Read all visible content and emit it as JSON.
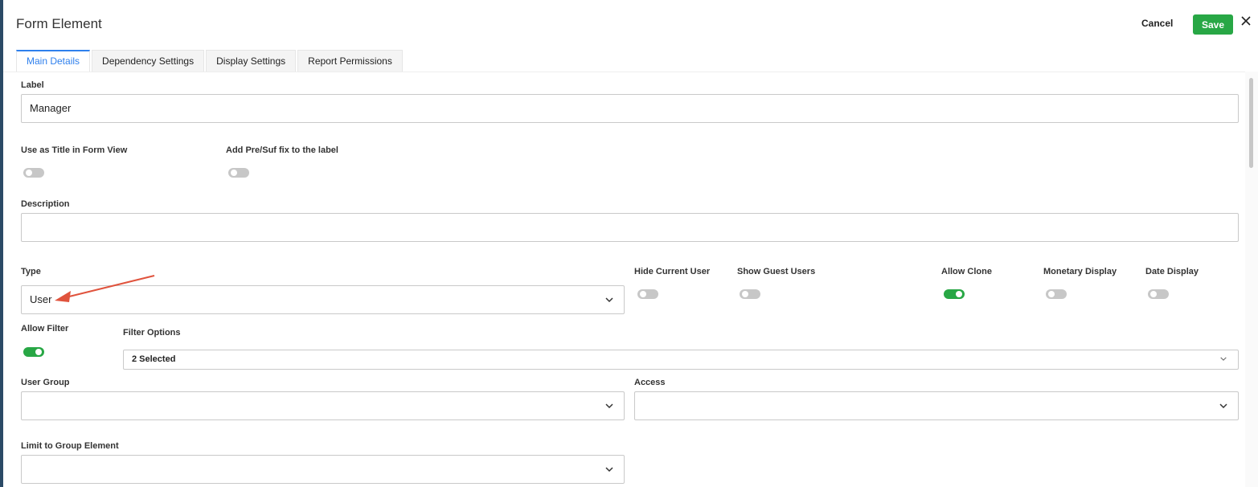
{
  "header": {
    "title": "Form Element",
    "cancel_label": "Cancel",
    "save_label": "Save"
  },
  "tabs": [
    {
      "label": "Main Details",
      "active": true
    },
    {
      "label": "Dependency Settings",
      "active": false
    },
    {
      "label": "Display Settings",
      "active": false
    },
    {
      "label": "Report Permissions",
      "active": false
    }
  ],
  "form": {
    "label": {
      "title": "Label",
      "value": "Manager"
    },
    "use_as_title": {
      "title": "Use as Title in Form View",
      "on": false
    },
    "add_prefix": {
      "title": "Add Pre/Suf fix to the label",
      "on": false
    },
    "description": {
      "title": "Description",
      "value": ""
    },
    "type": {
      "title": "Type",
      "value": "User"
    },
    "hide_current_user": {
      "title": "Hide Current User",
      "on": false
    },
    "show_guest_users": {
      "title": "Show Guest Users",
      "on": false
    },
    "allow_clone": {
      "title": "Allow Clone",
      "on": true
    },
    "monetary_display": {
      "title": "Monetary Display",
      "on": false
    },
    "date_display": {
      "title": "Date Display",
      "on": false
    },
    "allow_filter": {
      "title": "Allow Filter",
      "on": true
    },
    "filter_options": {
      "title": "Filter Options",
      "value": "2 Selected"
    },
    "user_group": {
      "title": "User Group",
      "value": ""
    },
    "access": {
      "title": "Access",
      "value": ""
    },
    "limit_to_group": {
      "title": "Limit to Group Element",
      "value": ""
    }
  },
  "colors": {
    "accent": "#2f80ed",
    "save_green": "#28a745",
    "toggle_on": "#28a745",
    "toggle_off": "#c7c7c7",
    "annotation_arrow": "#e0533d"
  }
}
